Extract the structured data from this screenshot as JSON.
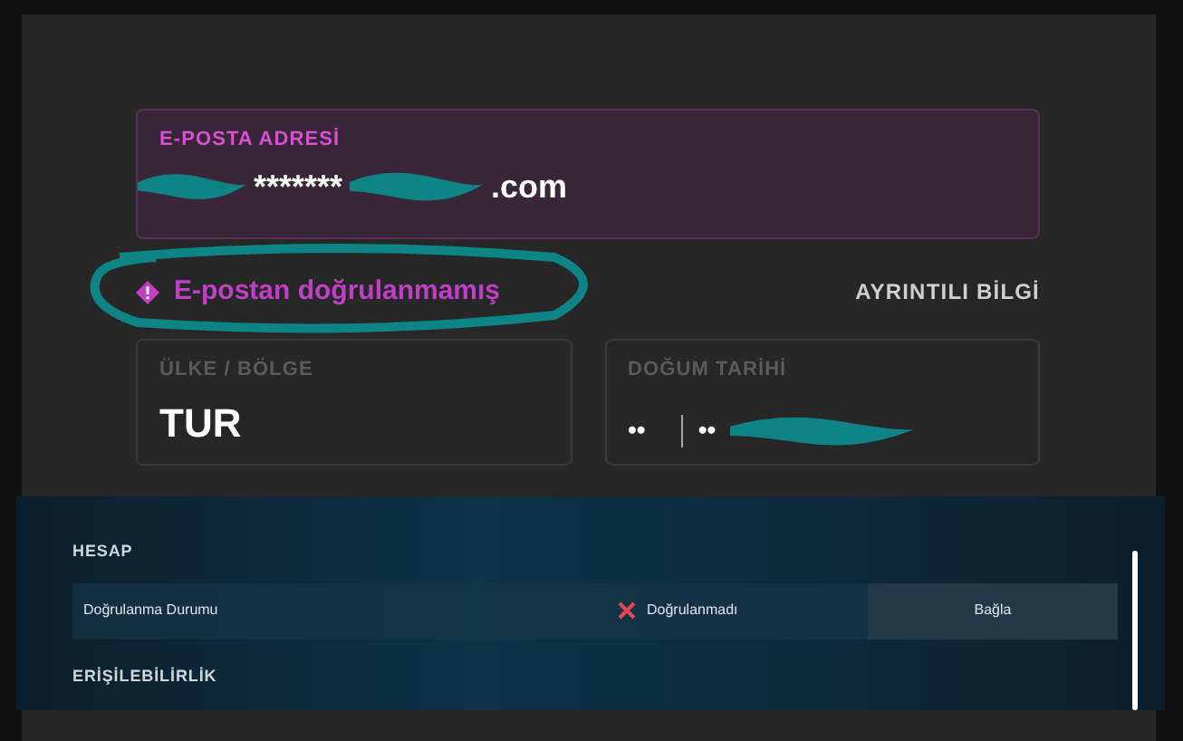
{
  "email": {
    "label": "E-POSTA ADRESİ",
    "shown": [
      "*******",
      ".com"
    ]
  },
  "warning": {
    "text": "E-postan doğrulanmamış",
    "link": "AYRINTILI BİLGİ"
  },
  "fields": [
    {
      "label": "ÜLKE / BÖLGE",
      "value": "TUR",
      "kind": "text"
    },
    {
      "label": "DOĞUM TARİHİ",
      "parts": [
        "••",
        "••"
      ],
      "kind": "date"
    }
  ],
  "sections": [
    {
      "title": "HESAP",
      "rows": [
        {
          "label": "Doğrulanma Durumu",
          "status": "Doğrulanmadı",
          "verified": false,
          "action": "Bağla"
        }
      ]
    },
    {
      "title": "ERİŞİLEBİLİRLİK"
    }
  ]
}
